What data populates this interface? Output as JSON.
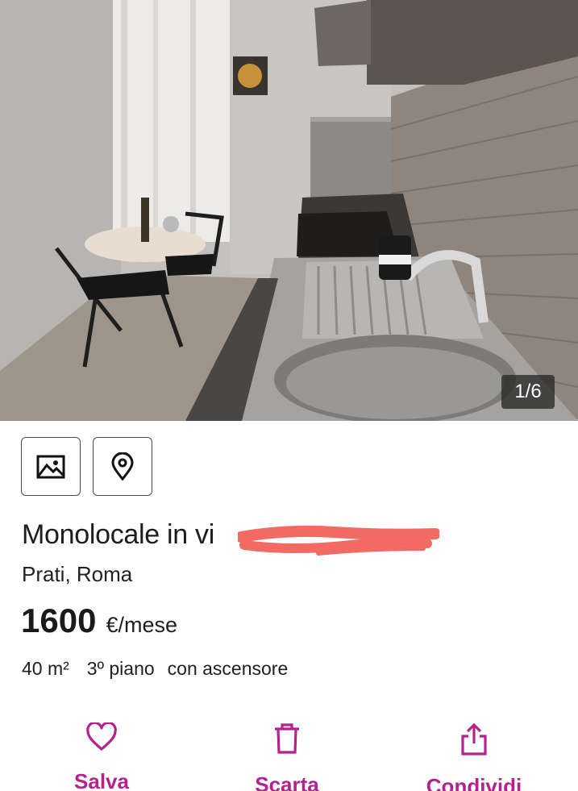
{
  "gallery": {
    "counter": "1/6",
    "photo_icon": "image-icon",
    "map_icon": "map-pin-icon"
  },
  "listing": {
    "title": "Monolocale in vi",
    "location": "Prati, Roma",
    "price": "1600",
    "price_unit": "€/mese",
    "features": {
      "area": "40 m²",
      "floor": "3º piano",
      "elevator": "con ascensore"
    }
  },
  "actions": {
    "save": {
      "label": "Salva",
      "icon": "heart-icon"
    },
    "discard": {
      "label": "Scarta",
      "icon": "trash-icon"
    },
    "share": {
      "label": "Condividi",
      "icon": "share-icon"
    }
  },
  "colors": {
    "accent": "#b3228f",
    "redaction": "#f26a62"
  }
}
